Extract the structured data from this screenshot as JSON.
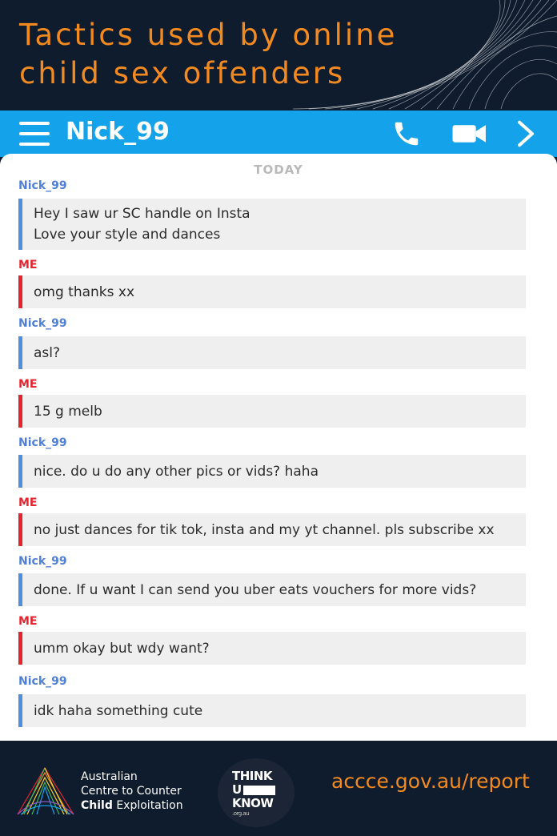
{
  "header": {
    "title_line1": "Tactics used by online",
    "title_line2": "child sex offenders"
  },
  "chat_bar": {
    "contact_name": "Nick_99",
    "icons": [
      "menu-icon",
      "phone-icon",
      "video-camera-icon",
      "chevron-right-icon"
    ]
  },
  "chat": {
    "date_divider": "TODAY",
    "messages": [
      {
        "sender": "Nick_99",
        "from": "them",
        "lines": [
          "Hey I saw ur SC handle on Insta",
          "Love your style and dances"
        ]
      },
      {
        "sender": "ME",
        "from": "me",
        "lines": [
          "omg thanks xx"
        ]
      },
      {
        "sender": "Nick_99",
        "from": "them",
        "lines": [
          "asl?"
        ]
      },
      {
        "sender": "ME",
        "from": "me",
        "lines": [
          "15 g melb"
        ]
      },
      {
        "sender": "Nick_99",
        "from": "them",
        "lines": [
          "nice. do u do any other pics or vids? haha"
        ]
      },
      {
        "sender": "ME",
        "from": "me",
        "lines": [
          "no just dances for tik tok, insta and my yt channel. pls subscribe xx"
        ]
      },
      {
        "sender": "Nick_99",
        "from": "them",
        "lines": [
          "done. If u want I can send you uber eats vouchers for more vids?"
        ]
      },
      {
        "sender": "ME",
        "from": "me",
        "lines": [
          "umm okay but wdy want?"
        ]
      },
      {
        "sender": "Nick_99",
        "from": "them",
        "lines": [
          "idk haha something cute"
        ]
      }
    ]
  },
  "footer": {
    "accce_line1": "Australian",
    "accce_line2": "Centre to Counter",
    "accce_line3_bold": "Child",
    "accce_line3_rest": " Exploitation",
    "thinkuknow_line1": "THINK",
    "thinkuknow_line2": "U",
    "thinkuknow_line3": "KNOW",
    "thinkuknow_small": ".org.au",
    "report_url": "accce.gov.au/report"
  },
  "colors": {
    "navy": "#0f1c2e",
    "orange": "#f38a1f",
    "chat_blue": "#14a3ea",
    "them_accent": "#4f8ee0",
    "me_accent": "#e32530"
  }
}
